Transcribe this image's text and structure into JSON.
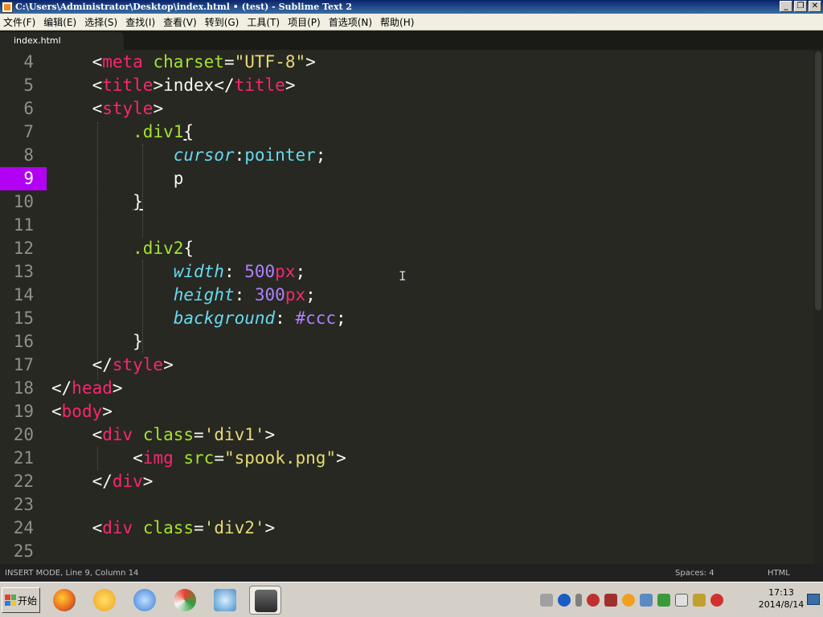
{
  "window": {
    "title": "C:\\Users\\Administrator\\Desktop\\index.html • (test) - Sublime Text 2",
    "buttons": [
      "_",
      "❐",
      "✕"
    ]
  },
  "menubar": {
    "items": [
      "文件(F)",
      "编辑(E)",
      "选择(S)",
      "查找(I)",
      "查看(V)",
      "转到(G)",
      "工具(T)",
      "项目(P)",
      "首选项(N)",
      "帮助(H)"
    ]
  },
  "tabs": [
    {
      "label": "index.html",
      "active": true
    }
  ],
  "editor": {
    "current_line": 9,
    "line_numbers": [
      "4",
      "5",
      "6",
      "7",
      "8",
      "9",
      "10",
      "11",
      "12",
      "13",
      "14",
      "15",
      "16",
      "17",
      "18",
      "19",
      "20",
      "21",
      "22",
      "23",
      "24",
      "25"
    ]
  },
  "statusbar": {
    "left": "INSERT MODE, Line 9, Column 14",
    "spaces": "Spaces: 4",
    "syntax": "HTML"
  },
  "taskbar": {
    "start_label": "开始",
    "apps": [
      {
        "name": "firefox-icon",
        "color": "#e8641c"
      },
      {
        "name": "qq-icon",
        "color": "#f0a020"
      },
      {
        "name": "search-magnifier-icon",
        "color": "#3a7bd5"
      },
      {
        "name": "umbrella-icon",
        "color": "#2ea043"
      },
      {
        "name": "screen-magnifier-icon",
        "color": "#4a90c8"
      },
      {
        "name": "sublime-text-icon",
        "color": "#4a4a4a"
      }
    ],
    "clock_time": "17:13",
    "clock_date": "2014/8/14"
  },
  "theme": {
    "background": "#272822",
    "current_line_marker": "#b200f5"
  }
}
